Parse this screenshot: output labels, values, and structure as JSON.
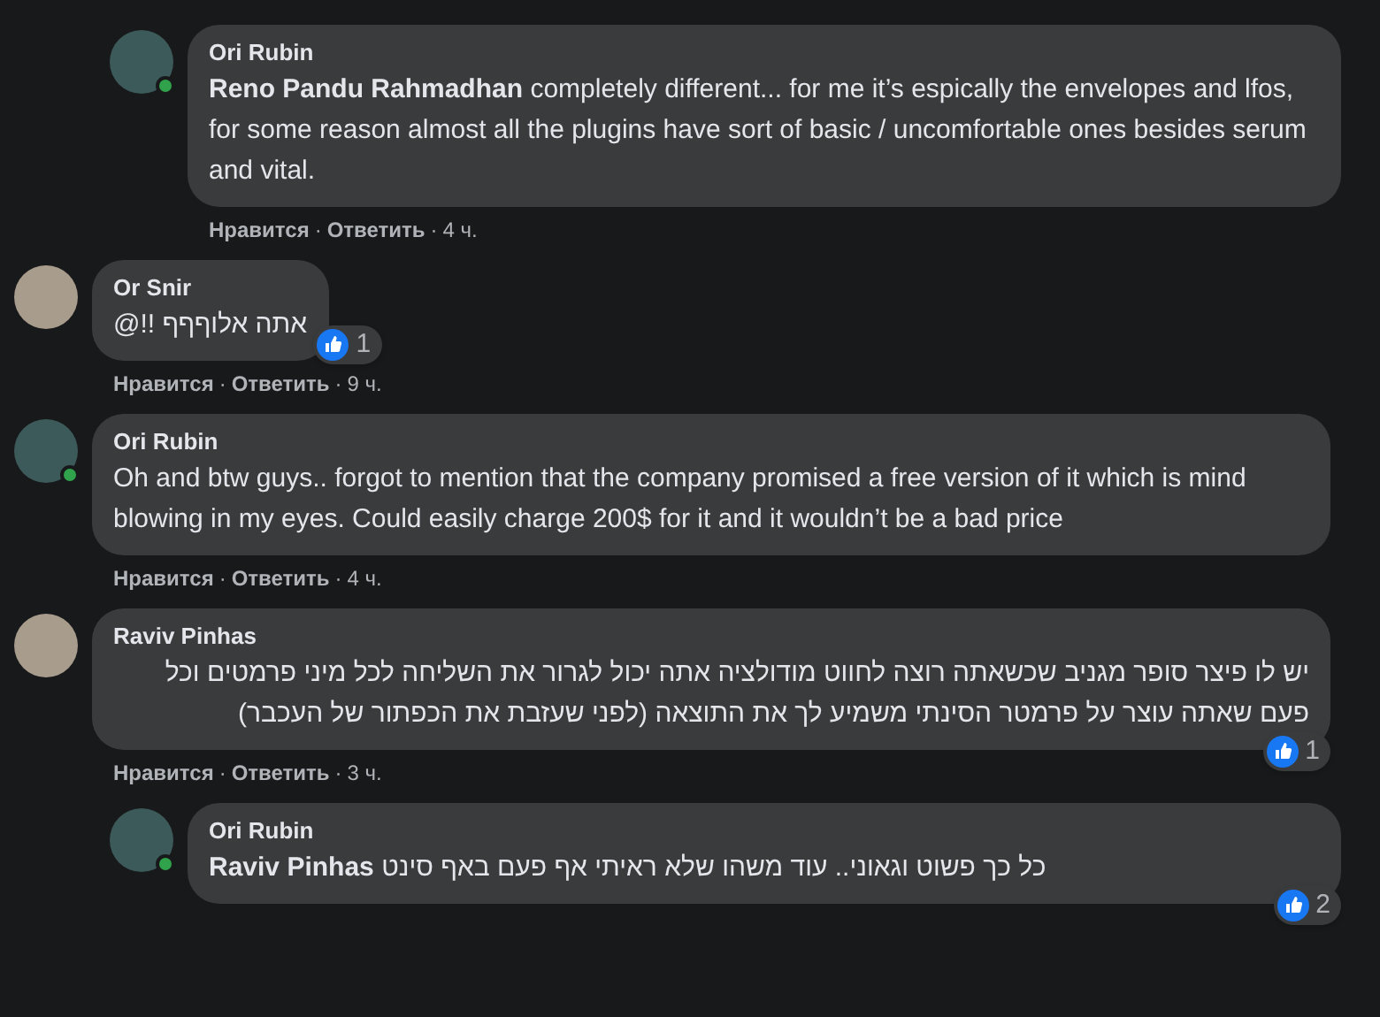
{
  "comments": [
    {
      "kind": "reply",
      "author": "Ori Rubin",
      "online": true,
      "rtl": false,
      "text": "**Reno Pandu Rahmadhan** completely different... for me it’s espically the envelopes and lfos, for some reason almost all the plugins have sort of basic / uncomfortable ones besides serum and vital.",
      "like": "Нравится",
      "sep1": "·",
      "reply": "Ответить",
      "sep2": "·",
      "time": "4 ч."
    },
    {
      "kind": "top",
      "author": "Or Snir",
      "online": false,
      "rtl": true,
      "text": "אתה אלוףףף !!@",
      "reactions": "1",
      "like": "Нравится",
      "sep1": "·",
      "reply": "Ответить",
      "sep2": "·",
      "time": "9 ч."
    },
    {
      "kind": "top",
      "author": "Ori Rubin",
      "online": true,
      "rtl": false,
      "text": "Oh and btw guys.. forgot to mention that the company promised a free version of it which is mind blowing in my eyes. Could easily charge 200$ for it and it wouldn’t be a bad price",
      "like": "Нравится",
      "sep1": "·",
      "reply": "Ответить",
      "sep2": "·",
      "time": "4 ч."
    },
    {
      "kind": "top",
      "author": "Raviv Pinhas",
      "online": false,
      "rtl": true,
      "text": "יש לו פיצר סופר מגניב שכשאתה רוצה לחווט מודולציה אתה יכול לגרור את השליחה לכל מיני פרמטים וכל פעם שאתה עוצר על פרמטר הסינתי משמיע לך את התוצאה (לפני שעזבת את הכפתור של העכבר)",
      "reactions": "1",
      "like": "Нравится",
      "sep1": "·",
      "reply": "Ответить",
      "sep2": "·",
      "time": "3 ч."
    },
    {
      "kind": "reply",
      "author": "Ori Rubin",
      "online": true,
      "rtl": false,
      "text": "**Raviv Pinhas** כל כך פשוט וגאוני.. עוד משהו שלא ראיתי אף פעם באף סינט",
      "reactions": "2"
    }
  ]
}
